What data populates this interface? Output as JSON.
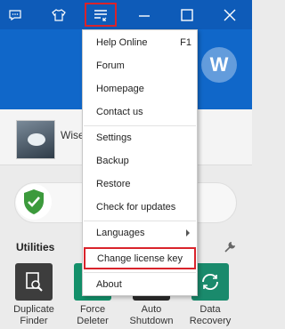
{
  "titlebar": {
    "icons": [
      "feedback-icon",
      "skin-icon",
      "main-menu-icon",
      "minimize-icon",
      "maximize-icon",
      "close-icon"
    ]
  },
  "header": {
    "logo_letter": "W"
  },
  "profile": {
    "name": "Wise"
  },
  "utilities": {
    "label": "Utilities",
    "tools": [
      {
        "line1": "Duplicate",
        "line2": "Finder",
        "color": "#3d3d3d",
        "icon": "duplicate-finder-icon"
      },
      {
        "line1": "Force",
        "line2": "Deleter",
        "color": "#13906a",
        "icon": "force-deleter-icon"
      },
      {
        "line1": "Auto",
        "line2": "Shutdown",
        "color": "#2a2a2a",
        "icon": "auto-shutdown-icon"
      },
      {
        "line1": "Data",
        "line2": "Recovery",
        "color": "#1a8a6c",
        "icon": "data-recovery-icon"
      }
    ]
  },
  "menu": {
    "items": [
      {
        "label": "Help Online",
        "shortcut": "F1"
      },
      {
        "label": "Forum"
      },
      {
        "label": "Homepage"
      },
      {
        "label": "Contact us"
      },
      {
        "label": "Settings"
      },
      {
        "label": "Backup"
      },
      {
        "label": "Restore"
      },
      {
        "label": "Check for updates"
      },
      {
        "label": "Languages",
        "submenu": true
      },
      {
        "label": "Change license key",
        "highlighted": true
      },
      {
        "label": "About"
      }
    ]
  },
  "colors": {
    "accent": "#0e5bb8",
    "highlight": "#d9232b"
  }
}
